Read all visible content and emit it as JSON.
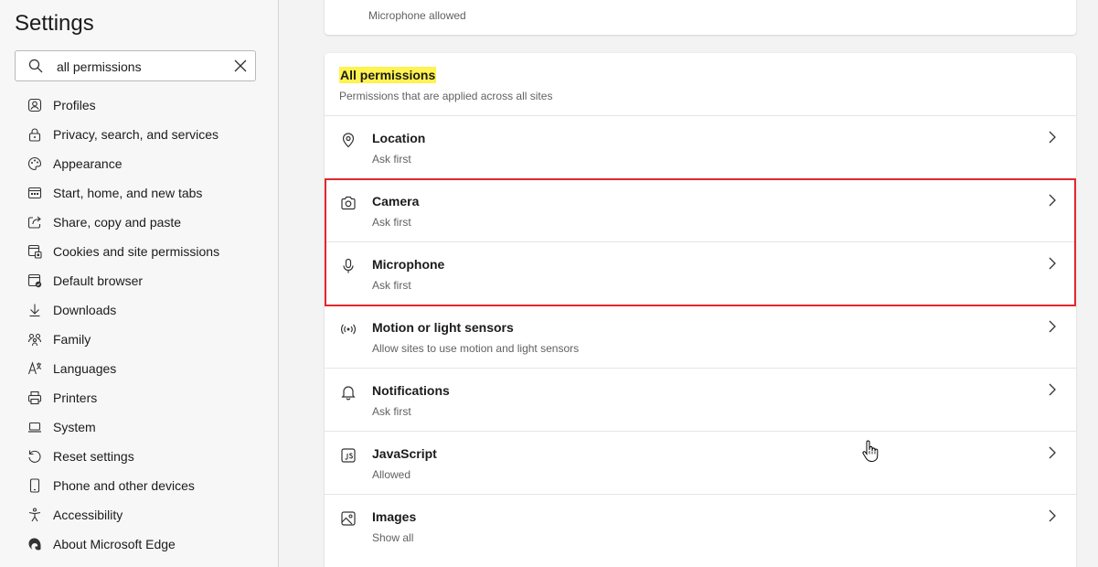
{
  "sidebar": {
    "title": "Settings",
    "search": {
      "value": "all permissions",
      "placeholder": "Search settings"
    },
    "items": [
      {
        "label": "Profiles",
        "icon": "profile-icon"
      },
      {
        "label": "Privacy, search, and services",
        "icon": "lock-icon"
      },
      {
        "label": "Appearance",
        "icon": "palette-icon"
      },
      {
        "label": "Start, home, and new tabs",
        "icon": "home-tabs-icon"
      },
      {
        "label": "Share, copy and paste",
        "icon": "share-icon"
      },
      {
        "label": "Cookies and site permissions",
        "icon": "cookies-icon"
      },
      {
        "label": "Default browser",
        "icon": "browser-icon"
      },
      {
        "label": "Downloads",
        "icon": "download-icon"
      },
      {
        "label": "Family",
        "icon": "family-icon"
      },
      {
        "label": "Languages",
        "icon": "languages-icon"
      },
      {
        "label": "Printers",
        "icon": "printer-icon"
      },
      {
        "label": "System",
        "icon": "laptop-icon"
      },
      {
        "label": "Reset settings",
        "icon": "reset-icon"
      },
      {
        "label": "Phone and other devices",
        "icon": "phone-icon"
      },
      {
        "label": "Accessibility",
        "icon": "accessibility-icon"
      },
      {
        "label": "About Microsoft Edge",
        "icon": "edge-icon"
      }
    ]
  },
  "top_card": {
    "status": "Microphone allowed"
  },
  "permissions": {
    "title": "All permissions",
    "subtitle": "Permissions that are applied across all sites",
    "rows": [
      {
        "label": "Location",
        "status": "Ask first",
        "icon": "location-icon"
      },
      {
        "label": "Camera",
        "status": "Ask first",
        "icon": "camera-icon"
      },
      {
        "label": "Microphone",
        "status": "Ask first",
        "icon": "microphone-icon"
      },
      {
        "label": "Motion or light sensors",
        "status": "Allow sites to use motion and light sensors",
        "icon": "sensors-icon"
      },
      {
        "label": "Notifications",
        "status": "Ask first",
        "icon": "bell-icon"
      },
      {
        "label": "JavaScript",
        "status": "Allowed",
        "icon": "javascript-icon"
      },
      {
        "label": "Images",
        "status": "Show all",
        "icon": "image-icon"
      }
    ]
  },
  "colors": {
    "highlight": "#fff34f",
    "annotation_box": "#e0282e"
  }
}
